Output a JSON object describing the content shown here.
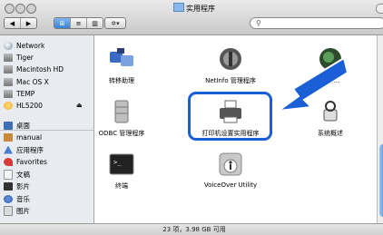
{
  "window": {
    "title": "实用程序",
    "status": "23 项，3.98 GB 可用",
    "search": {
      "value": "",
      "placeholder": ""
    }
  },
  "toolbar": {
    "back_label": "◀",
    "forward_label": "▶",
    "view_icon": "⊞",
    "view_list": "≡",
    "view_column": "▥",
    "action_label": "✲▾"
  },
  "sidebar": {
    "devices": [
      {
        "label": "Network",
        "icon": "network-icon",
        "eject": false
      },
      {
        "label": "Tiger",
        "icon": "hard-drive-icon",
        "eject": false
      },
      {
        "label": "Macintosh HD",
        "icon": "hard-drive-icon",
        "eject": false
      },
      {
        "label": "Mac OS X",
        "icon": "hard-drive-icon",
        "eject": false
      },
      {
        "label": "TEMP",
        "icon": "hard-drive-icon",
        "eject": false
      },
      {
        "label": "HL5200",
        "icon": "disk-icon",
        "eject": true
      }
    ],
    "places": [
      {
        "label": "桌面",
        "icon": "desktop-icon"
      },
      {
        "label": "manual",
        "icon": "home-icon"
      },
      {
        "label": "应用程序",
        "icon": "applications-icon"
      },
      {
        "label": "Favorites",
        "icon": "favorites-icon"
      },
      {
        "label": "文稿",
        "icon": "documents-icon"
      },
      {
        "label": "影片",
        "icon": "movies-icon"
      },
      {
        "label": "音乐",
        "icon": "music-icon"
      },
      {
        "label": "图片",
        "icon": "pictures-icon"
      }
    ]
  },
  "items": [
    {
      "label": "转移助理",
      "icon": "migration-assistant-icon"
    },
    {
      "label": "NetInfo 管理程序",
      "icon": "netinfo-icon"
    },
    {
      "label": "网络...",
      "icon": "network-utility-icon"
    },
    {
      "label": "ODBC 管理程序",
      "icon": "odbc-icon"
    },
    {
      "label": "打印机设置实用程序",
      "icon": "printer-setup-icon"
    },
    {
      "label": "系统概述",
      "icon": "system-profiler-icon"
    },
    {
      "label": "终端",
      "icon": "terminal-icon"
    },
    {
      "label": "VoiceOver Utility",
      "icon": "voiceover-icon"
    }
  ],
  "colors": {
    "highlight": "#1a5fd6",
    "accent": "#3b82d6"
  }
}
